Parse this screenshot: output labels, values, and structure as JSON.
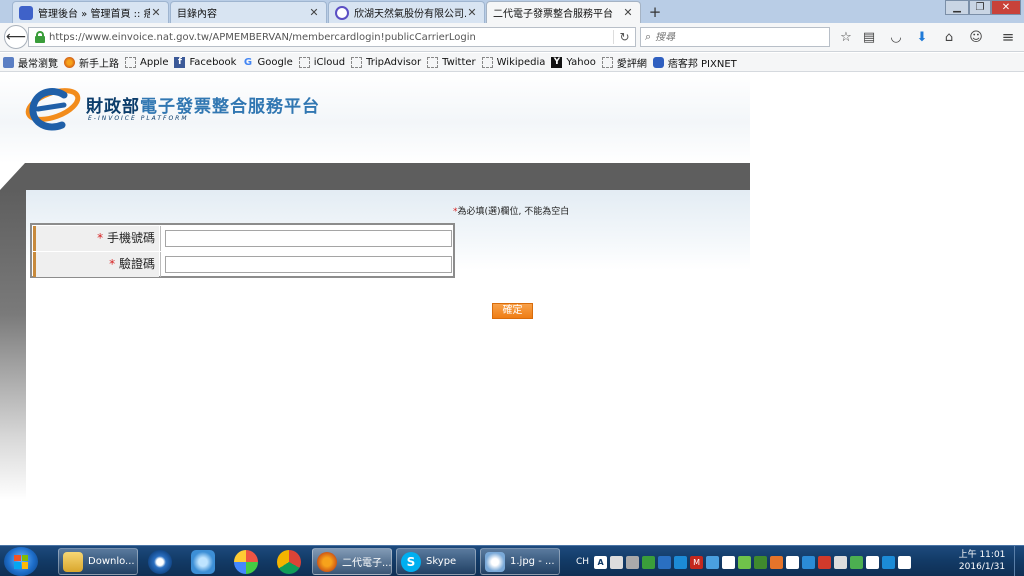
{
  "browser": {
    "tabs": [
      {
        "title": "管理後台 » 管理首頁 :: 痞...",
        "favicon_color": "#3f62c9"
      },
      {
        "title": "目錄內容",
        "favicon_color": ""
      },
      {
        "title": "欣湖天然氣股份有限公司...",
        "favicon_color": "#5b4fc4"
      },
      {
        "title": "二代電子發票整合服務平台",
        "favicon_color": ""
      }
    ],
    "active_tab_index": 3,
    "url": "https://www.einvoice.nat.gov.tw/APMEMBERVAN/membercardlogin!publicCarrierLogin",
    "search_placeholder": "搜尋",
    "window_controls": [
      "minimize",
      "restore",
      "close"
    ]
  },
  "bookmarks": [
    {
      "label": "最常瀏覽",
      "icon": "bookmark-page-icon"
    },
    {
      "label": "新手上路",
      "icon": "firefox-icon"
    },
    {
      "label": "Apple",
      "icon": "blank-folder-icon"
    },
    {
      "label": "Facebook",
      "icon": "facebook-icon"
    },
    {
      "label": "Google",
      "icon": "google-icon"
    },
    {
      "label": "iCloud",
      "icon": "blank-folder-icon"
    },
    {
      "label": "TripAdvisor",
      "icon": "blank-folder-icon"
    },
    {
      "label": "Twitter",
      "icon": "blank-folder-icon"
    },
    {
      "label": "Wikipedia",
      "icon": "blank-folder-icon"
    },
    {
      "label": "Yahoo",
      "icon": "yahoo-icon"
    },
    {
      "label": "愛評網",
      "icon": "blank-folder-icon"
    },
    {
      "label": "痞客邦 PIXNET",
      "icon": "pixnet-icon"
    }
  ],
  "site": {
    "title_part1": "財政部",
    "title_part2": "電子發票整合服務平台",
    "subtitle": "E-INVOICE PLATFORM",
    "required_note_star": "*",
    "required_note": "為必填(選)欄位, 不能為空白",
    "form": {
      "fields": [
        {
          "label": "手機號碼",
          "value": ""
        },
        {
          "label": "驗證碼",
          "value": ""
        }
      ]
    },
    "confirm_label": "確定"
  },
  "taskbar": {
    "buttons": [
      {
        "label": "Downlo...",
        "icon": "folder-icon"
      },
      {
        "label": "",
        "icon": "browser-icon"
      },
      {
        "label": "",
        "icon": "network-icon"
      },
      {
        "label": "",
        "icon": "color-wheel-icon"
      },
      {
        "label": "",
        "icon": "chrome-icon"
      },
      {
        "label": "二代電子...",
        "icon": "firefox-icon"
      },
      {
        "label": "Skype",
        "icon": "skype-icon"
      },
      {
        "label": "1.jpg - ...",
        "icon": "paint-icon"
      }
    ],
    "tray_lang": "CH",
    "clock_time": "上午 11:01",
    "clock_date": "2016/1/31"
  }
}
